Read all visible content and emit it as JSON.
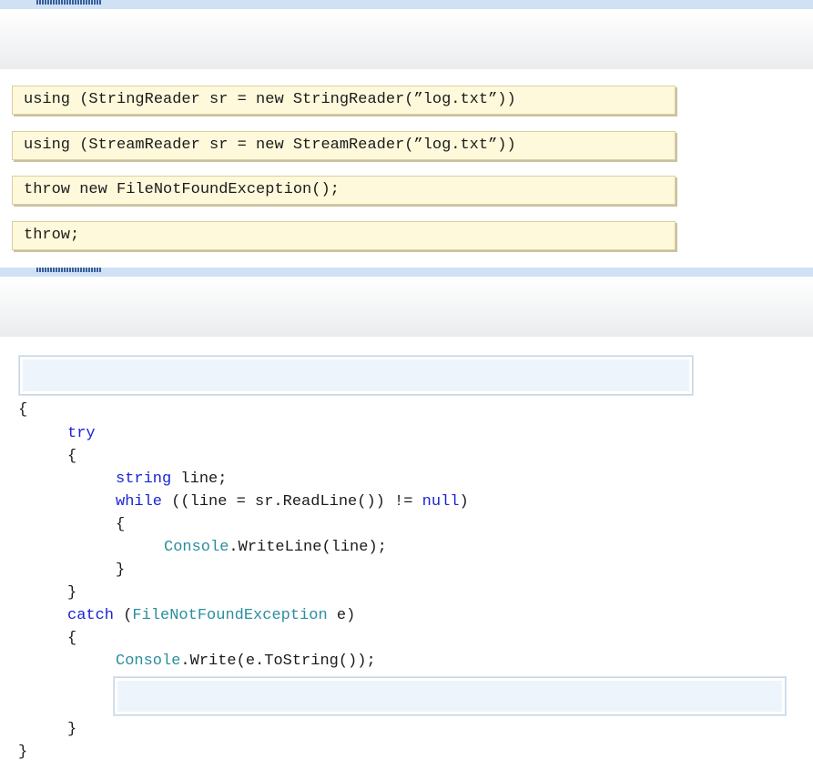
{
  "choices_section": {
    "items": [
      "using (StringReader sr = new StringReader(”log.txt”))",
      "using (StreamReader sr = new StreamReader(”log.txt”))",
      "throw new FileNotFoundException();",
      "throw;"
    ]
  },
  "code": {
    "open_brace": "{",
    "try_kw": "try",
    "try_open": "{",
    "string_kw": "string",
    "string_rest": " line;",
    "while_kw": "while",
    "while_mid": " ((line = sr.ReadLine()) != ",
    "null_kw": "null",
    "while_end": ")",
    "while_open": "{",
    "console_type_1": "Console",
    "writeline_rest": ".WriteLine(line);",
    "while_close": "}",
    "try_close": "}",
    "catch_kw": "catch",
    "catch_open_paren": " (",
    "exception_type": "FileNotFoundException",
    "catch_rest": " e)",
    "catch_open": "{",
    "console_type_2": "Console",
    "write_rest": ".Write(e.ToString());",
    "catch_close": "}",
    "close_brace": "}"
  },
  "colors": {
    "keyword": "#1a24d4",
    "type": "#2b8e9f",
    "choice_bg": "#fff9dc",
    "drop_target_bg": "#eef4fb",
    "section_bar": "#cfe2f5"
  }
}
